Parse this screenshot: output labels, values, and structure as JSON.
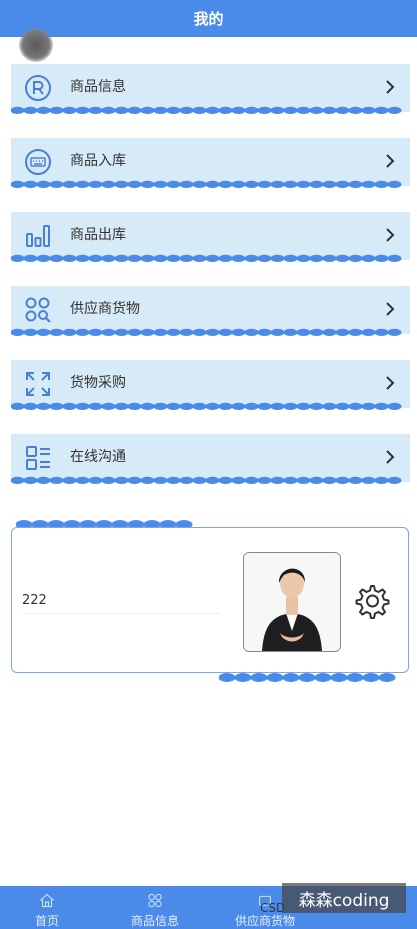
{
  "header": {
    "title": "我的"
  },
  "menu": [
    {
      "label": "商品信息",
      "icon": "registered-icon"
    },
    {
      "label": "商品入库",
      "icon": "keyboard-icon"
    },
    {
      "label": "商品出库",
      "icon": "bar-chart-icon"
    },
    {
      "label": "供应商货物",
      "icon": "grid-search-icon"
    },
    {
      "label": "货物采购",
      "icon": "expand-arrows-icon"
    },
    {
      "label": "在线沟通",
      "icon": "list-icon"
    }
  ],
  "profile": {
    "value": "222"
  },
  "tabs": [
    {
      "label": "首页",
      "icon": "home-icon"
    },
    {
      "label": "商品信息",
      "icon": "grid-circles-icon"
    },
    {
      "label": "供应商货物",
      "icon": "supplier-icon"
    }
  ],
  "watermark": {
    "left": "CSD",
    "box": "森森coding"
  },
  "colors": {
    "primary": "#4a8ae8",
    "menu_bg": "#d6ebf7"
  }
}
